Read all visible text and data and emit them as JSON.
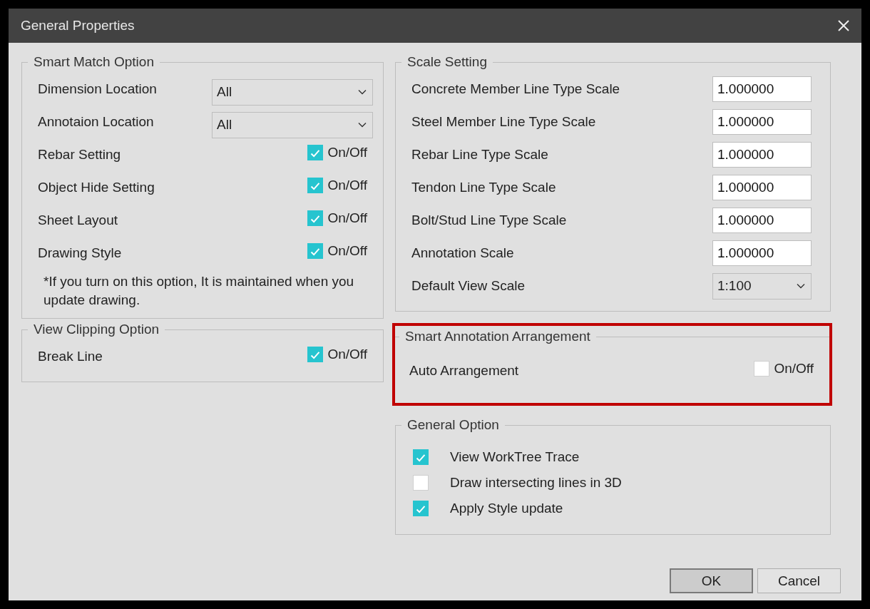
{
  "window": {
    "title": "General Properties"
  },
  "left_column": [
    {
      "title": "Smart Match Option",
      "highlighted": false,
      "rows": [
        {
          "kind": "dropdown",
          "label": "Dimension Location",
          "value": "All"
        },
        {
          "kind": "dropdown",
          "label": "Annotaion Location",
          "value": "All"
        },
        {
          "kind": "toggle",
          "label": "Rebar Setting",
          "option": "On/Off",
          "checked": true
        },
        {
          "kind": "toggle",
          "label": "Object Hide Setting",
          "option": "On/Off",
          "checked": true
        },
        {
          "kind": "toggle",
          "label": "Sheet Layout",
          "option": "On/Off",
          "checked": true
        },
        {
          "kind": "toggle",
          "label": "Drawing Style",
          "option": "On/Off",
          "checked": true
        }
      ],
      "note": "*If you turn on this option, It is maintained when you update drawing."
    },
    {
      "title": "View Clipping Option",
      "highlighted": false,
      "rows": [
        {
          "kind": "toggle",
          "label": "Break Line",
          "option": "On/Off",
          "checked": true
        }
      ]
    }
  ],
  "right_column": [
    {
      "title": "Scale Setting",
      "highlighted": false,
      "rows": [
        {
          "kind": "input",
          "label": "Concrete Member Line Type Scale",
          "value": "1.000000"
        },
        {
          "kind": "input",
          "label": "Steel Member Line Type Scale",
          "value": "1.000000"
        },
        {
          "kind": "input",
          "label": "Rebar Line Type Scale",
          "value": "1.000000"
        },
        {
          "kind": "input",
          "label": "Tendon Line Type Scale",
          "value": "1.000000"
        },
        {
          "kind": "input",
          "label": "Bolt/Stud Line Type Scale",
          "value": "1.000000"
        },
        {
          "kind": "input",
          "label": "Annotation Scale",
          "value": "1.000000"
        },
        {
          "kind": "dropdown",
          "label": "Default View Scale",
          "value": "1:100"
        }
      ]
    },
    {
      "title": "Smart Annotation Arrangement",
      "highlighted": true,
      "rows": [
        {
          "kind": "toggle",
          "label": "Auto Arrangement",
          "option": "On/Off",
          "checked": false
        }
      ]
    },
    {
      "title": "General Option",
      "highlighted": false,
      "rows": [
        {
          "kind": "check",
          "label": "View WorkTree Trace",
          "checked": true
        },
        {
          "kind": "check",
          "label": "Draw intersecting lines in 3D",
          "checked": false
        },
        {
          "kind": "check",
          "label": "Apply Style update",
          "checked": true
        }
      ]
    }
  ],
  "buttons": [
    {
      "label": "OK",
      "default": true
    },
    {
      "label": "Cancel",
      "default": false
    }
  ]
}
